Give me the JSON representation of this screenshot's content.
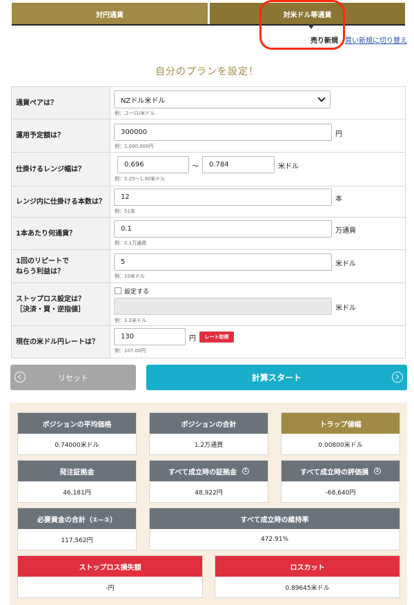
{
  "tabs": {
    "yen_pairs": "対円通貨",
    "usd_pairs": "対米ドル等通貨"
  },
  "mode": {
    "sell_label": "売り新規",
    "switch_link": "買い新規に切り替え"
  },
  "plan_title": "自分のプランを設定！",
  "form": {
    "pair": {
      "label": "通貨ペアは？",
      "value": "NZドル米ドル",
      "hint": "例：ユーロ/米ドル"
    },
    "budget": {
      "label": "運用予定額は？",
      "value": "300000",
      "unit": "円",
      "hint": "例：1,000,000円"
    },
    "range": {
      "label": "仕掛けるレンジ幅は？",
      "low": "0.696",
      "sep": "～",
      "high": "0.784",
      "unit": "米ドル",
      "hint": "例：1.25～1.30米ドル"
    },
    "count": {
      "label": "レンジ内に仕掛ける本数は？",
      "value": "12",
      "unit": "本",
      "hint": "例：51本"
    },
    "per_trap": {
      "label": "1本あたり何通貨？",
      "value": "0.1",
      "unit": "万通貨",
      "hint": "例：0.1万通貨"
    },
    "profit": {
      "label_line1": "1回のリピートで",
      "label_line2": "ねらう利益は？",
      "value": "5",
      "unit": "米ドル",
      "hint": "例：10米ドル"
    },
    "stoploss": {
      "label_line1": "ストップロス設定は？",
      "label_line2": "［決済・買・逆指値］",
      "checkbox_label": "設定する",
      "value": "",
      "unit": "米ドル",
      "hint": "例：1.2米ドル"
    },
    "rate": {
      "label": "現在の米ドル円レートは？",
      "value": "130",
      "unit": "円",
      "button": "レート取得",
      "hint": "例：107.00円"
    }
  },
  "buttons": {
    "reset": "リセット",
    "start": "計算スタート"
  },
  "results": {
    "avg_price": {
      "title": "ポジションの平均価格",
      "value": "0.74000米ドル"
    },
    "total_position": {
      "title": "ポジションの合計",
      "value": "1.2万通貨"
    },
    "trap_width": {
      "title": "トラップ値幅",
      "value": "0.00800米ドル"
    },
    "margin": {
      "title": "発注証拠金",
      "value": "46,181円"
    },
    "margin_all": {
      "title": "すべて成立時の証拠金",
      "badge": "1",
      "value": "48,922円"
    },
    "loss_all": {
      "title": "すべて成立時の評価損",
      "badge": "2",
      "value": "-68,640円"
    },
    "required": {
      "title": "必要資金の合計（①−②）",
      "value": "117,562円"
    },
    "maint_ratio": {
      "title": "すべて成立時の維持率",
      "value": "472.91%"
    },
    "stoploss_amount": {
      "title": "ストップロス損失額",
      "value": "-円"
    },
    "losscut": {
      "title": "ロスカット",
      "value": "0.89645米ドル"
    }
  },
  "colors": {
    "gold": "#a08a45",
    "gray_header": "#6b737a",
    "red": "#e03040",
    "cyan": "#18aecb",
    "highlight": "#ff2a0a"
  }
}
